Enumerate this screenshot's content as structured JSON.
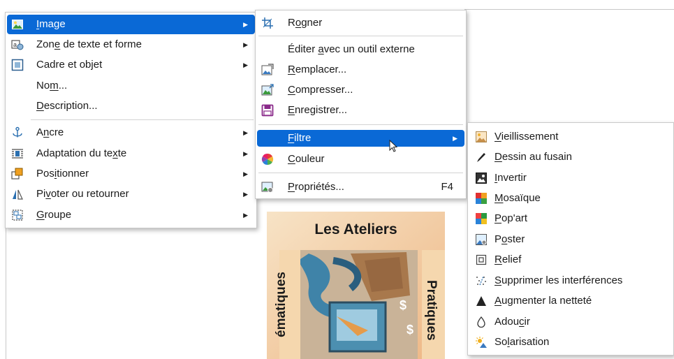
{
  "main_menu": {
    "items": [
      {
        "label": "Image",
        "mnemonic": "I",
        "icon": "image-icon",
        "has_submenu": true,
        "highlighted": true
      },
      {
        "label": "Zone de texte et forme",
        "mnemonic": "e",
        "icon": "text-shape-icon",
        "has_submenu": true
      },
      {
        "label": "Cadre et objet",
        "mnemonic": "j",
        "icon": "frame-object-icon",
        "has_submenu": true
      },
      {
        "label": "Nom...",
        "mnemonic": "m",
        "icon": "",
        "has_submenu": false
      },
      {
        "label": "Description...",
        "mnemonic": "D",
        "icon": "",
        "has_submenu": false
      },
      {
        "label": "Ancre",
        "mnemonic": "n",
        "icon": "anchor-icon",
        "has_submenu": true
      },
      {
        "label": "Adaptation du texte",
        "mnemonic": "x",
        "icon": "text-wrap-icon",
        "has_submenu": true
      },
      {
        "label": "Positionner",
        "mnemonic": "i",
        "icon": "arrange-icon",
        "has_submenu": true
      },
      {
        "label": "Pivoter ou retourner",
        "mnemonic": "v",
        "icon": "rotate-flip-icon",
        "has_submenu": true
      },
      {
        "label": "Groupe",
        "mnemonic": "G",
        "icon": "group-icon",
        "has_submenu": true
      }
    ]
  },
  "image_menu": {
    "items": [
      {
        "label": "Rogner",
        "mnemonic": "o",
        "icon": "crop-icon"
      },
      {
        "label": "Éditer avec un outil externe",
        "mnemonic": "a",
        "icon": ""
      },
      {
        "label": "Remplacer...",
        "mnemonic": "R",
        "icon": "replace-image-icon"
      },
      {
        "label": "Compresser...",
        "mnemonic": "C",
        "icon": "compress-image-icon"
      },
      {
        "label": "Enregistrer...",
        "mnemonic": "E",
        "icon": "save-icon"
      },
      {
        "label": "Filtre",
        "mnemonic": "F",
        "icon": "",
        "has_submenu": true,
        "highlighted": true
      },
      {
        "label": "Couleur",
        "mnemonic": "C",
        "icon": "color-wheel-icon"
      },
      {
        "label": "Propriétés...",
        "mnemonic": "P",
        "icon": "properties-icon",
        "shortcut": "F4"
      }
    ]
  },
  "filter_menu": {
    "items": [
      {
        "label": "Vieillissement",
        "mnemonic": "V",
        "icon": "aging-icon"
      },
      {
        "label": "Dessin au fusain",
        "mnemonic": "D",
        "icon": "charcoal-icon"
      },
      {
        "label": "Invertir",
        "mnemonic": "I",
        "icon": "invert-icon"
      },
      {
        "label": "Mosaïque",
        "mnemonic": "M",
        "icon": "mosaic-icon"
      },
      {
        "label": "Pop'art",
        "mnemonic": "P",
        "icon": "pop-art-icon"
      },
      {
        "label": "Poster",
        "mnemonic": "o",
        "icon": "poster-icon"
      },
      {
        "label": "Relief",
        "mnemonic": "R",
        "icon": "relief-icon"
      },
      {
        "label": "Supprimer les interférences",
        "mnemonic": "S",
        "icon": "remove-noise-icon"
      },
      {
        "label": "Augmenter la netteté",
        "mnemonic": "A",
        "icon": "sharpen-icon"
      },
      {
        "label": "Adoucir",
        "mnemonic": "c",
        "icon": "smooth-icon"
      },
      {
        "label": "Solarisation",
        "mnemonic": "l",
        "icon": "solarization-icon"
      }
    ]
  },
  "document_image": {
    "title": "Les Ateliers",
    "left_text": "ématiques",
    "right_text": "Pratiques"
  },
  "colors": {
    "highlight": "#0a69d6",
    "menu_bg": "#ffffff",
    "separator": "#d2d2d2"
  }
}
